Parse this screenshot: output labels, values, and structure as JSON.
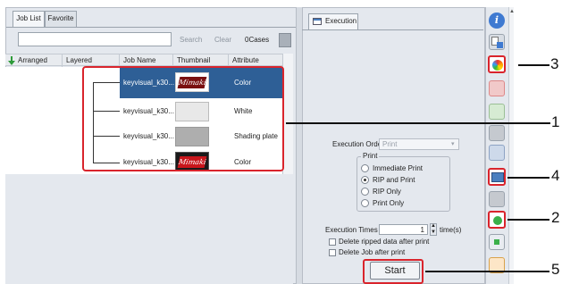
{
  "job_list": {
    "tabs": [
      "Job List",
      "Favorite"
    ],
    "search_label": "Search",
    "clear_label": "Clear",
    "count_label": "0Cases",
    "columns": [
      "Arranged",
      "Layered",
      "Job Name",
      "Thumbnail",
      "Attribute"
    ],
    "rows": [
      {
        "name": "keyvisual_k30...",
        "attribute": "Color",
        "selected": true
      },
      {
        "name": "keyvisual_k30...",
        "attribute": "White",
        "selected": false
      },
      {
        "name": "keyvisual_k30...",
        "attribute": "Shading plate",
        "selected": false
      },
      {
        "name": "keyvisual_k30...",
        "attribute": "Color",
        "selected": false
      }
    ],
    "thumbnail_logo": "Mimaki"
  },
  "execution": {
    "tab_label": "Execution",
    "order_label": "Execution Order",
    "order_value": "Print",
    "print_group_label": "Print",
    "print_options": [
      {
        "label": "Immediate Print",
        "checked": false
      },
      {
        "label": "RIP and Print",
        "checked": true
      },
      {
        "label": "RIP Only",
        "checked": false
      },
      {
        "label": "Print Only",
        "checked": false
      }
    ],
    "times_label": "Execution Times",
    "times_value": "1",
    "times_unit": "time(s)",
    "checkboxes": [
      {
        "label": "Delete ripped data after print",
        "checked": false
      },
      {
        "label": "Delete Job after print",
        "checked": false
      }
    ],
    "start_label": "Start"
  },
  "callouts": [
    "1",
    "2",
    "3",
    "4",
    "5"
  ],
  "colors": {
    "selection": "#2e5f96",
    "highlight": "#d9242c"
  }
}
